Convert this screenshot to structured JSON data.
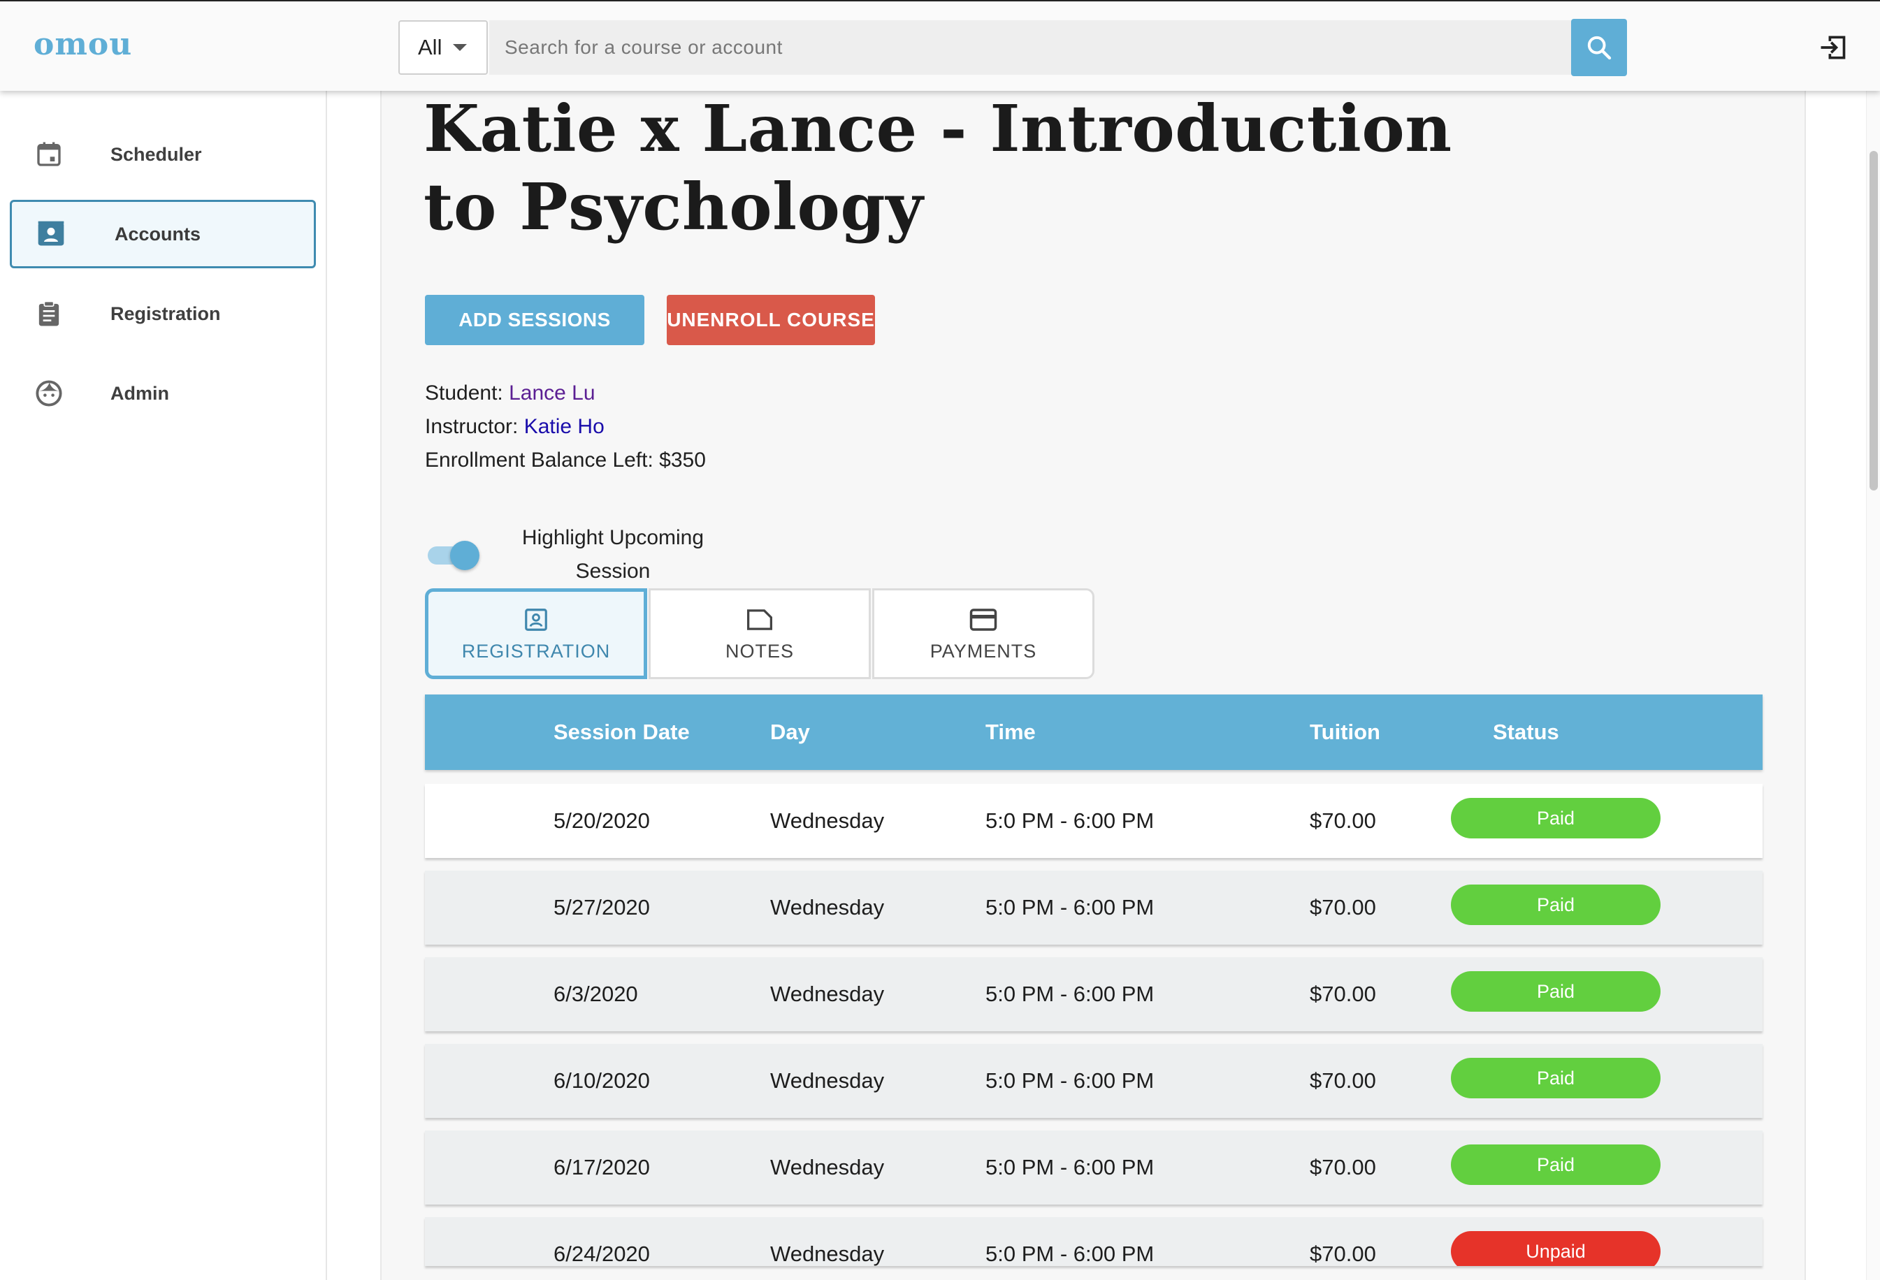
{
  "app": {
    "logo": "omou"
  },
  "search": {
    "filter": "All",
    "placeholder": "Search for a course or account"
  },
  "sidebar": {
    "items": [
      {
        "label": "Scheduler",
        "icon": "calendar-icon"
      },
      {
        "label": "Accounts",
        "icon": "contact-card-icon",
        "active": true
      },
      {
        "label": "Registration",
        "icon": "clipboard-icon"
      },
      {
        "label": "Admin",
        "icon": "face-icon"
      }
    ]
  },
  "page": {
    "title": "Katie x Lance - Introduction to Psychology",
    "buttons": {
      "add_sessions": "ADD SESSIONS",
      "unenroll": "UNENROLL COURSE"
    },
    "student_label": "Student:",
    "student_name": "Lance Lu",
    "instructor_label": "Instructor:",
    "instructor_name": "Katie Ho",
    "balance": "Enrollment Balance Left: $350",
    "toggle_label": "Highlight Upcoming Session",
    "toggle_on": true
  },
  "tabs": [
    {
      "label": "REGISTRATION",
      "icon": "contact-card-icon",
      "active": true
    },
    {
      "label": "NOTES",
      "icon": "note-icon"
    },
    {
      "label": "PAYMENTS",
      "icon": "credit-card-icon"
    }
  ],
  "table": {
    "headers": [
      "Session Date",
      "Day",
      "Time",
      "Tuition",
      "Status"
    ],
    "rows": [
      {
        "date": "5/20/2020",
        "day": "Wednesday",
        "time": "5:0 PM - 6:00 PM",
        "tuition": "$70.00",
        "status": "Paid"
      },
      {
        "date": "5/27/2020",
        "day": "Wednesday",
        "time": "5:0 PM - 6:00 PM",
        "tuition": "$70.00",
        "status": "Paid"
      },
      {
        "date": "6/3/2020",
        "day": "Wednesday",
        "time": "5:0 PM - 6:00 PM",
        "tuition": "$70.00",
        "status": "Paid"
      },
      {
        "date": "6/10/2020",
        "day": "Wednesday",
        "time": "5:0 PM - 6:00 PM",
        "tuition": "$70.00",
        "status": "Paid"
      },
      {
        "date": "6/17/2020",
        "day": "Wednesday",
        "time": "5:0 PM - 6:00 PM",
        "tuition": "$70.00",
        "status": "Paid"
      },
      {
        "date": "6/24/2020",
        "day": "Wednesday",
        "time": "5:0 PM - 6:00 PM",
        "tuition": "$70.00",
        "status": "Unpaid"
      }
    ]
  },
  "colors": {
    "accent": "#5faed6",
    "paid": "#62cf3f",
    "unpaid": "#e63329",
    "danger": "#d9594a"
  }
}
